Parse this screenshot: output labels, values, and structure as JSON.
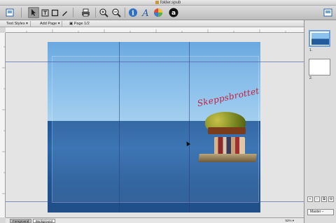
{
  "window": {
    "title": "folder.spub"
  },
  "toolbar": {
    "tools": [
      {
        "name": "document-icon"
      },
      {
        "name": "arrow-tool-icon"
      },
      {
        "name": "text-frame-tool-icon"
      },
      {
        "name": "rectangle-tool-icon"
      },
      {
        "name": "pencil-tool-icon"
      },
      {
        "name": "print-icon"
      },
      {
        "name": "zoom-in-icon"
      },
      {
        "name": "zoom-out-icon"
      },
      {
        "name": "info-icon"
      },
      {
        "name": "fonts-icon"
      },
      {
        "name": "colors-icon"
      },
      {
        "name": "amazon-icon"
      },
      {
        "name": "sidebar-toggle-icon"
      }
    ]
  },
  "formatbar": {
    "text_styles": "Text Styles",
    "add_page": "Add Page",
    "page_indicator": "Page 1/2"
  },
  "canvas": {
    "handwriting": "Skeppsbrottet"
  },
  "bottom": {
    "tab_foreground": "Foreground",
    "tab_background": "Background",
    "zoom": "52%"
  },
  "sidebar": {
    "pages": [
      {
        "label": "1."
      },
      {
        "label": "2."
      }
    ],
    "master": "Master –"
  }
}
